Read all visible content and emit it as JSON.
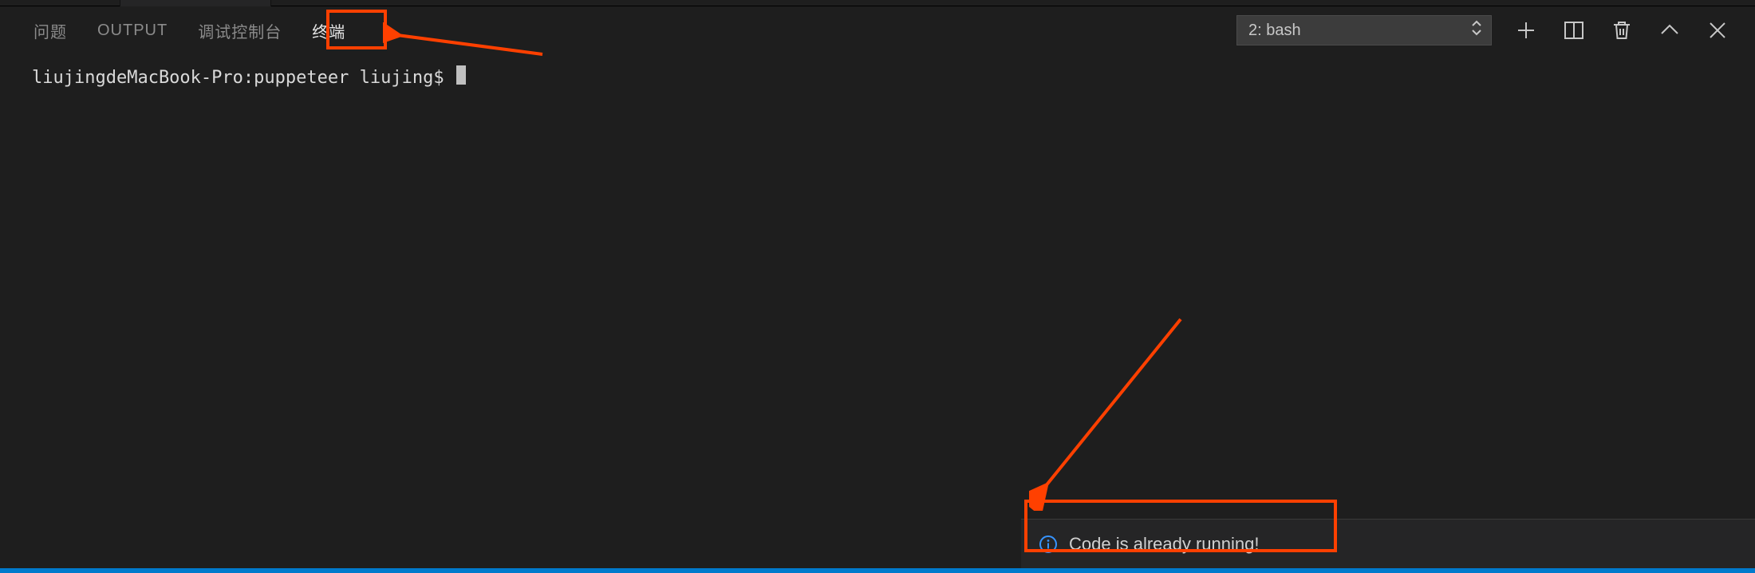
{
  "panel": {
    "tabs": {
      "problems": "问题",
      "output": "OUTPUT",
      "debug_console": "调试控制台",
      "terminal": "终端"
    },
    "terminal_select": "2: bash"
  },
  "terminal": {
    "prompt": "liujingdeMacBook-Pro:puppeteer liujing$ "
  },
  "notification": {
    "message": "Code is already running!"
  },
  "annotation": {
    "color": "#ff4000"
  }
}
